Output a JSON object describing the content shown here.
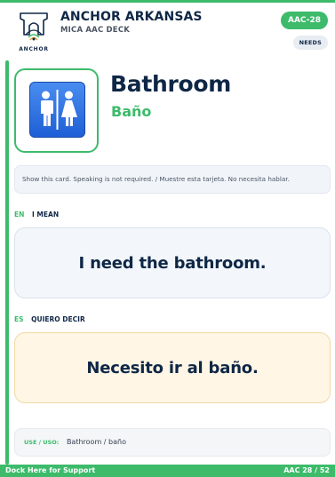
{
  "colors": {
    "accent": "#3dbb6b",
    "navy": "#0f2746",
    "icon_blue": "#1f5fd6",
    "es_box_bg": "#fff6e5",
    "en_box_bg": "#f3f7fb"
  },
  "header": {
    "logo_icon": "anchor-arch-logo",
    "logo_word": "ANCHOR",
    "brand_title": "ANCHOR ARKANSAS",
    "brand_subtitle": "MICA AAC DECK",
    "card_id": "AAC-28",
    "category": "NEEDS"
  },
  "card": {
    "icon": "restroom-icon",
    "word_en": "Bathroom",
    "word_es": "Baño",
    "instruction": "Show this card. Speaking is not required. / Muestre esta tarjeta. No necesita hablar."
  },
  "english": {
    "code": "EN",
    "label": "I MEAN",
    "phrase": "I need the bathroom."
  },
  "spanish": {
    "code": "ES",
    "label": "QUIERO DECIR",
    "phrase": "Necesito ir al baño."
  },
  "use": {
    "label": "USE / USO:",
    "value": "Bathroom / baño"
  },
  "footer": {
    "left": "Dock Here for Support",
    "right": "AAC 28 / 52"
  }
}
